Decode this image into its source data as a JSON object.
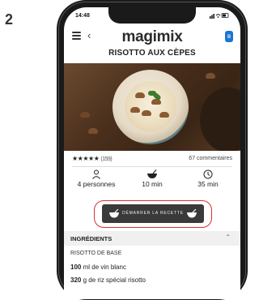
{
  "step_number": "2",
  "status": {
    "time": "14:48",
    "icons": "signal-wifi-battery"
  },
  "nav": {
    "logo": "magimix"
  },
  "recipe": {
    "title": "RISOTTO AUX CÈPES",
    "stars": "★★★★★",
    "rating_count": "(159)",
    "comments": "67 commentaires",
    "servings": "4 personnes",
    "prep_time": "10 min",
    "cook_time": "35 min",
    "start_button": "DÉMARRER LA RECETTE"
  },
  "ingredients": {
    "header": "INGRÉDIENTS",
    "section": "RISOTTO DE BASE",
    "items": [
      {
        "qty": "100",
        "text": "ml de vin blanc"
      },
      {
        "qty": "320",
        "text": "g de riz spécial risotto"
      }
    ]
  },
  "colors": {
    "highlight_ring": "#d63030",
    "button_bg": "#3a3a3a"
  }
}
